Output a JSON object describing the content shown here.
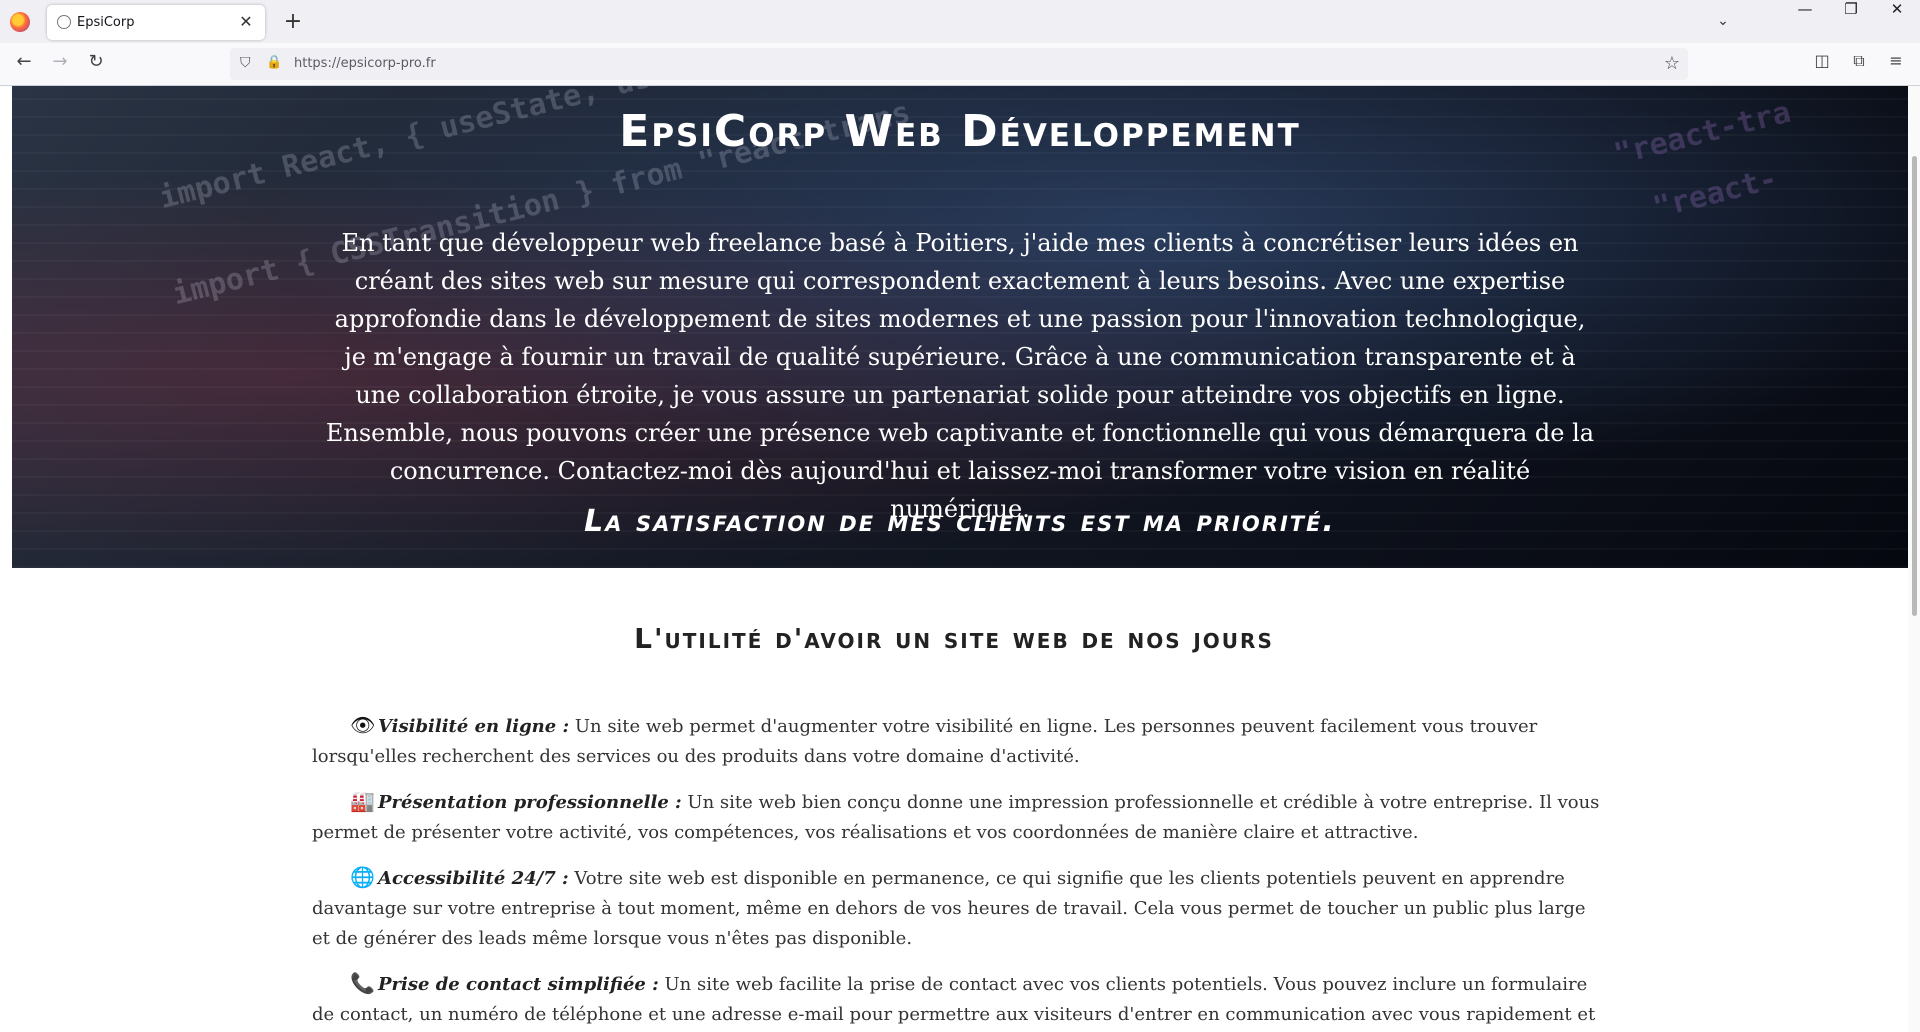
{
  "browser": {
    "tab_title": "EpsiCorp",
    "url": "https://epsicorp-pro.fr",
    "icons": {
      "firefox": "firefox-logo",
      "tab_close": "✕",
      "new_tab": "+",
      "tab_list": "⌄",
      "minimize": "—",
      "maximize": "❐",
      "close": "✕",
      "back": "←",
      "forward": "→",
      "reload": "↻",
      "shield": "⛉",
      "lock": "🔒",
      "star": "☆",
      "pocket": "◫",
      "extensions": "⧉",
      "menu": "≡"
    }
  },
  "hero": {
    "title": "EpsiCorp Web Développement",
    "text": "En tant que développeur web freelance basé à Poitiers, j'aide mes clients à concrétiser leurs idées en créant des sites web sur mesure qui correspondent exactement à leurs besoins. Avec une expertise approfondie dans le développement de sites modernes et une passion pour l'innovation technologique, je m'engage à fournir un travail de qualité supérieure. Grâce à une communication transparente et à une collaboration étroite, je vous assure un partenariat solide pour atteindre vos objectifs en ligne. Ensemble, nous pouvons créer une présence web captivante et fonctionnelle qui vous démarquera de la concurrence. Contactez-moi dès aujourd'hui et laissez-moi transformer votre vision en réalité numérique.",
    "tagline": "La satisfaction de mes clients est ma priorité.",
    "background_code": [
      "import React, { useState, useE",
      "import { CSSTransition } from \"react-trans",
      "\"react-tra",
      "\"react-"
    ]
  },
  "section": {
    "title": "L'utilité d'avoir un site web de nos jours"
  },
  "features": [
    {
      "icon": "👁",
      "icon_name": "eye-icon",
      "label": "Visibilité en ligne :",
      "text": " Un site web permet d'augmenter votre visibilité en ligne. Les personnes peuvent facilement vous trouver lorsqu'elles recherchent des services ou des produits dans votre domaine d'activité."
    },
    {
      "icon": "🏭",
      "icon_name": "industry-icon",
      "label": "Présentation professionnelle :",
      "text": " Un site web bien conçu donne une impression professionnelle et crédible à votre entreprise. Il vous permet de présenter votre activité, vos compétences, vos réalisations et vos coordonnées de manière claire et attractive."
    },
    {
      "icon": "🌐",
      "icon_name": "globe-icon",
      "label": "Accessibilité 24/7 :",
      "text": " Votre site web est disponible en permanence, ce qui signifie que les clients potentiels peuvent en apprendre davantage sur votre entreprise à tout moment, même en dehors de vos heures de travail. Cela vous permet de toucher un public plus large et de générer des leads même lorsque vous n'êtes pas disponible."
    },
    {
      "icon": "📞",
      "icon_name": "phone-icon",
      "label": "Prise de contact simplifiée :",
      "text": " Un site web facilite la prise de contact avec vos clients potentiels. Vous pouvez inclure un formulaire de contact, un numéro de téléphone et une adresse e-mail pour permettre aux visiteurs d'entrer en communication avec vous rapidement et"
    }
  ]
}
